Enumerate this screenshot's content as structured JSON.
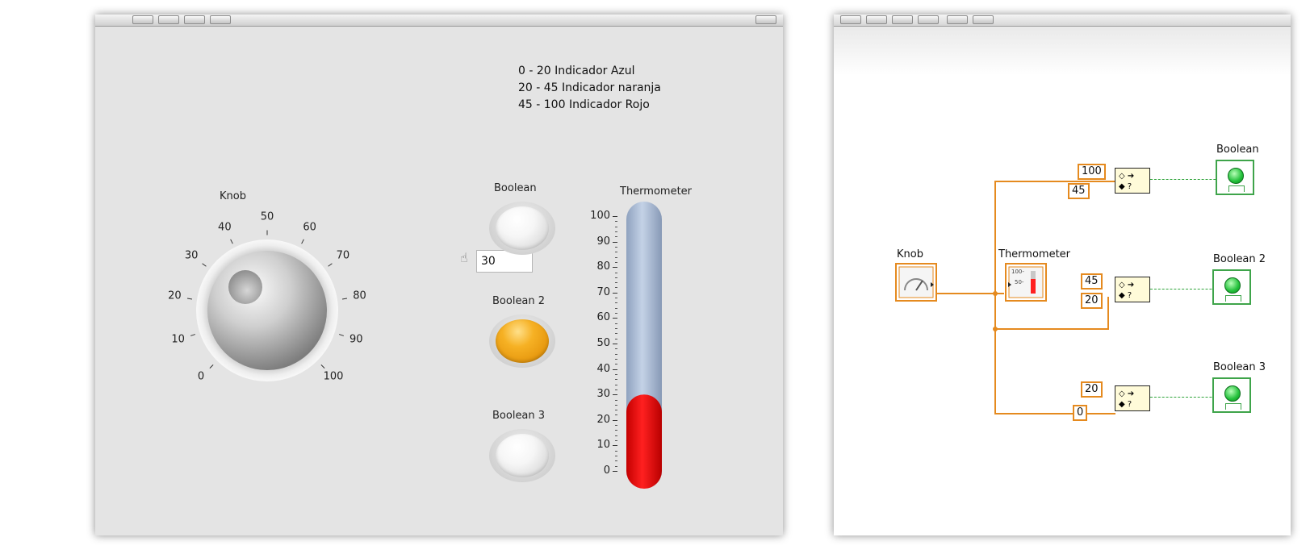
{
  "front_panel": {
    "notes": [
      "0 - 20 Indicador Azul",
      "20 - 45 Indicador naranja",
      "45 - 100 Indicador Rojo"
    ],
    "knob": {
      "label": "Knob",
      "value": "30",
      "scale": [
        "0",
        "10",
        "20",
        "30",
        "40",
        "50",
        "60",
        "70",
        "80",
        "90",
        "100"
      ]
    },
    "booleans": [
      {
        "label": "Boolean",
        "state": "off"
      },
      {
        "label": "Boolean 2",
        "state": "on",
        "color": "#f2a516"
      },
      {
        "label": "Boolean 3",
        "state": "off"
      }
    ],
    "thermometer": {
      "label": "Thermometer",
      "value": 30,
      "scale": [
        "100",
        "90",
        "80",
        "70",
        "60",
        "50",
        "40",
        "30",
        "20",
        "10",
        "0"
      ],
      "fill_color": "#ff0000",
      "empty_color": "#a8b8d0"
    }
  },
  "block_diagram": {
    "knob_label": "Knob",
    "thermometer_label": "Thermometer",
    "terminal_labels": {
      "thermo_100": "100-",
      "thermo_50": "50-"
    },
    "indicator_labels": [
      "Boolean",
      "Boolean 2",
      "Boolean 3"
    ],
    "ranges": [
      {
        "upper": "100",
        "lower": "45"
      },
      {
        "upper": "45",
        "lower": "20"
      },
      {
        "upper": "20",
        "lower": "0"
      }
    ],
    "wire_color": "#e58a1f"
  }
}
